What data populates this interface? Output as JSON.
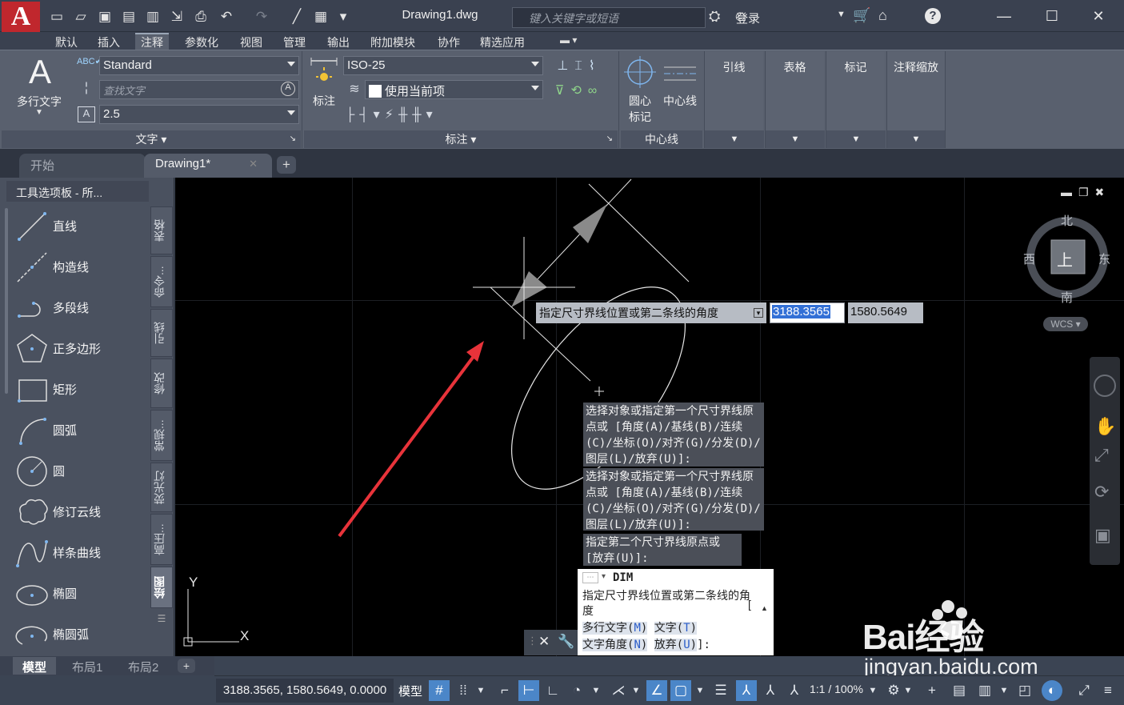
{
  "titlebar": {
    "app_logo": "A",
    "document": "Drawing1.dwg",
    "search_placeholder": "键入关键字或短语",
    "login": "登录"
  },
  "menu_tabs": [
    "默认",
    "插入",
    "注释",
    "参数化",
    "视图",
    "管理",
    "输出",
    "附加模块",
    "协作",
    "精选应用"
  ],
  "active_menu_tab": "注释",
  "ribbon": {
    "text_panel": {
      "mtext_label": "多行文字",
      "style": "Standard",
      "find_placeholder": "查找文字",
      "height": "2.5",
      "panel_title": "文字"
    },
    "dim_panel": {
      "dim_label": "标注",
      "dimstyle": "ISO-25",
      "layer": "使用当前项",
      "panel_title": "标注"
    },
    "center_panel": {
      "center_mark_label": "圆心\n标记",
      "centerline_label": "中心线",
      "panel_title": "中心线"
    },
    "collapsed_panels": [
      "引线",
      "表格",
      "标记",
      "注释缩放"
    ]
  },
  "doc_tabs": {
    "start": "开始",
    "drawing": "Drawing1*"
  },
  "palette": {
    "title": "工具选项板 - 所...",
    "items": [
      "直线",
      "构造线",
      "多段线",
      "正多边形",
      "矩形",
      "圆弧",
      "圆",
      "修订云线",
      "样条曲线",
      "椭圆",
      "椭圆弧"
    ],
    "side_tabs": [
      "表格",
      "命令...",
      "引线",
      "修改",
      "常规...",
      "荧光灯",
      "高压...",
      "绘图"
    ]
  },
  "canvas": {
    "viewcube": {
      "north": "北",
      "south": "南",
      "east": "东",
      "west": "西",
      "top": "上",
      "wcs": "WCS"
    },
    "dynamic_prompt": "指定尺寸界线位置或第二条线的角度",
    "input_x": "3188.3565",
    "input_y": "1580.5649",
    "history": [
      "选择对象或指定第一个尺寸界线原点或 [角度(A)/基线(B)/连续(C)/坐标(O)/对齐(G)/分发(D)/图层(L)/放弃(U)]:",
      "选择对象或指定第一个尺寸界线原点或 [角度(A)/基线(B)/连续(C)/坐标(O)/对齐(G)/分发(D)/图层(L)/放弃(U)]:",
      "指定第二个尺寸界线原点或 [放弃(U)]:"
    ],
    "ucs_x": "X",
    "ucs_y": "Y"
  },
  "command": {
    "name": "DIM",
    "prompt": "指定尺寸界线位置或第二条线的角度",
    "bracket": "[",
    "options": [
      {
        "text": "多行文字(",
        "key": "M",
        "close": ")"
      },
      {
        "text": "文字(",
        "key": "T",
        "close": ")"
      },
      {
        "text": "文字角度(",
        "key": "N",
        "close": ")"
      },
      {
        "text": "放弃(",
        "key": "U",
        "close": ")"
      }
    ],
    "suffix": "]:"
  },
  "layout_tabs": [
    "模型",
    "布局1",
    "布局2"
  ],
  "status": {
    "coords": "3188.3565, 1580.5649, 0.0000",
    "model": "模型",
    "scale": "1:1 / 100%"
  },
  "watermark": {
    "brand": "Bai经验",
    "url": "jingyan.baidu.com"
  },
  "colors": {
    "accent": "#4b86c8",
    "logo_red": "#c0272d",
    "arrow_red": "#e8333a",
    "canvas": "#000000"
  }
}
